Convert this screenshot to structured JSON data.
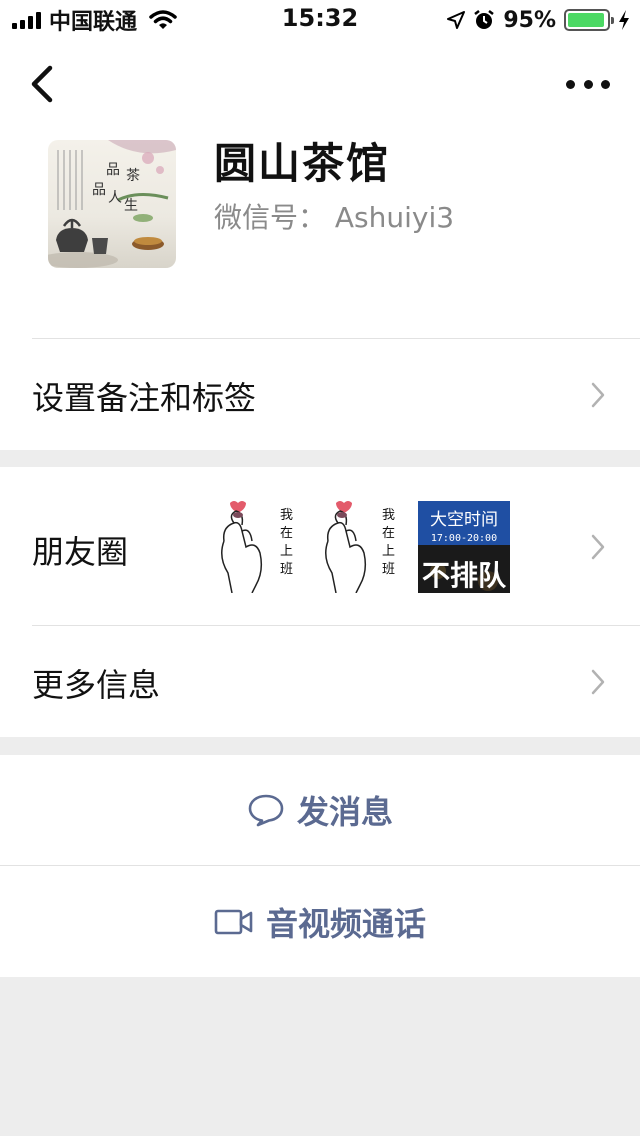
{
  "status_bar": {
    "carrier": "中国联通",
    "time": "15:32",
    "battery_percent": "95%",
    "battery_level": 0.95,
    "battery_color": "#4cd964"
  },
  "nav": {
    "back_icon": "chevron-left-icon",
    "more_icon": "more-dots-icon"
  },
  "profile": {
    "name": "圆山茶馆",
    "wechat_id": "微信号：  Ashuiyi3",
    "avatar_text": [
      "品",
      "茶",
      "品",
      "人",
      "生"
    ]
  },
  "menu": {
    "remarks_label": "设置备注和标签",
    "moments_label": "朋友圈",
    "more_info_label": "更多信息"
  },
  "moments_thumbs": [
    {
      "text": [
        "我",
        "在",
        "上",
        "班"
      ]
    },
    {
      "text": [
        "我",
        "在",
        "上",
        "班"
      ]
    },
    {
      "title": "大空时间",
      "subtitle": "17:00-20:00",
      "big": "不排队"
    }
  ],
  "actions": {
    "message_label": "发消息",
    "video_call_label": "音视频通话"
  },
  "colors": {
    "accent": "#5b6a91",
    "background": "#ededed"
  }
}
